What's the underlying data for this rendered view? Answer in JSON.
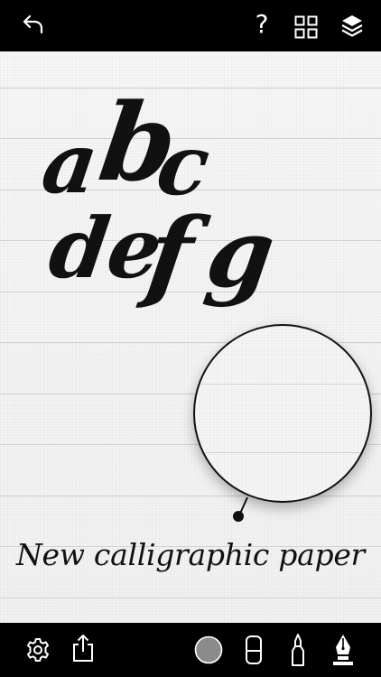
{
  "caption": "New calligraphic paper",
  "letters": [
    "a",
    "b",
    "c",
    "d",
    "e",
    "f",
    "g"
  ],
  "icons": {
    "top": [
      "undo-icon",
      "help-icon",
      "grid-icon",
      "layers-icon"
    ],
    "bottom": [
      "settings-icon",
      "share-icon",
      "color-swatch-icon",
      "eraser-icon",
      "marker-pen-icon",
      "calligraphy-pen-icon"
    ]
  },
  "help_glyph": "?",
  "colors": {
    "bar": "#000000",
    "paper": "#f4f4f4",
    "rule": "#cfcfcf",
    "ink": "#111111",
    "swatch": "#8a8a8a"
  }
}
